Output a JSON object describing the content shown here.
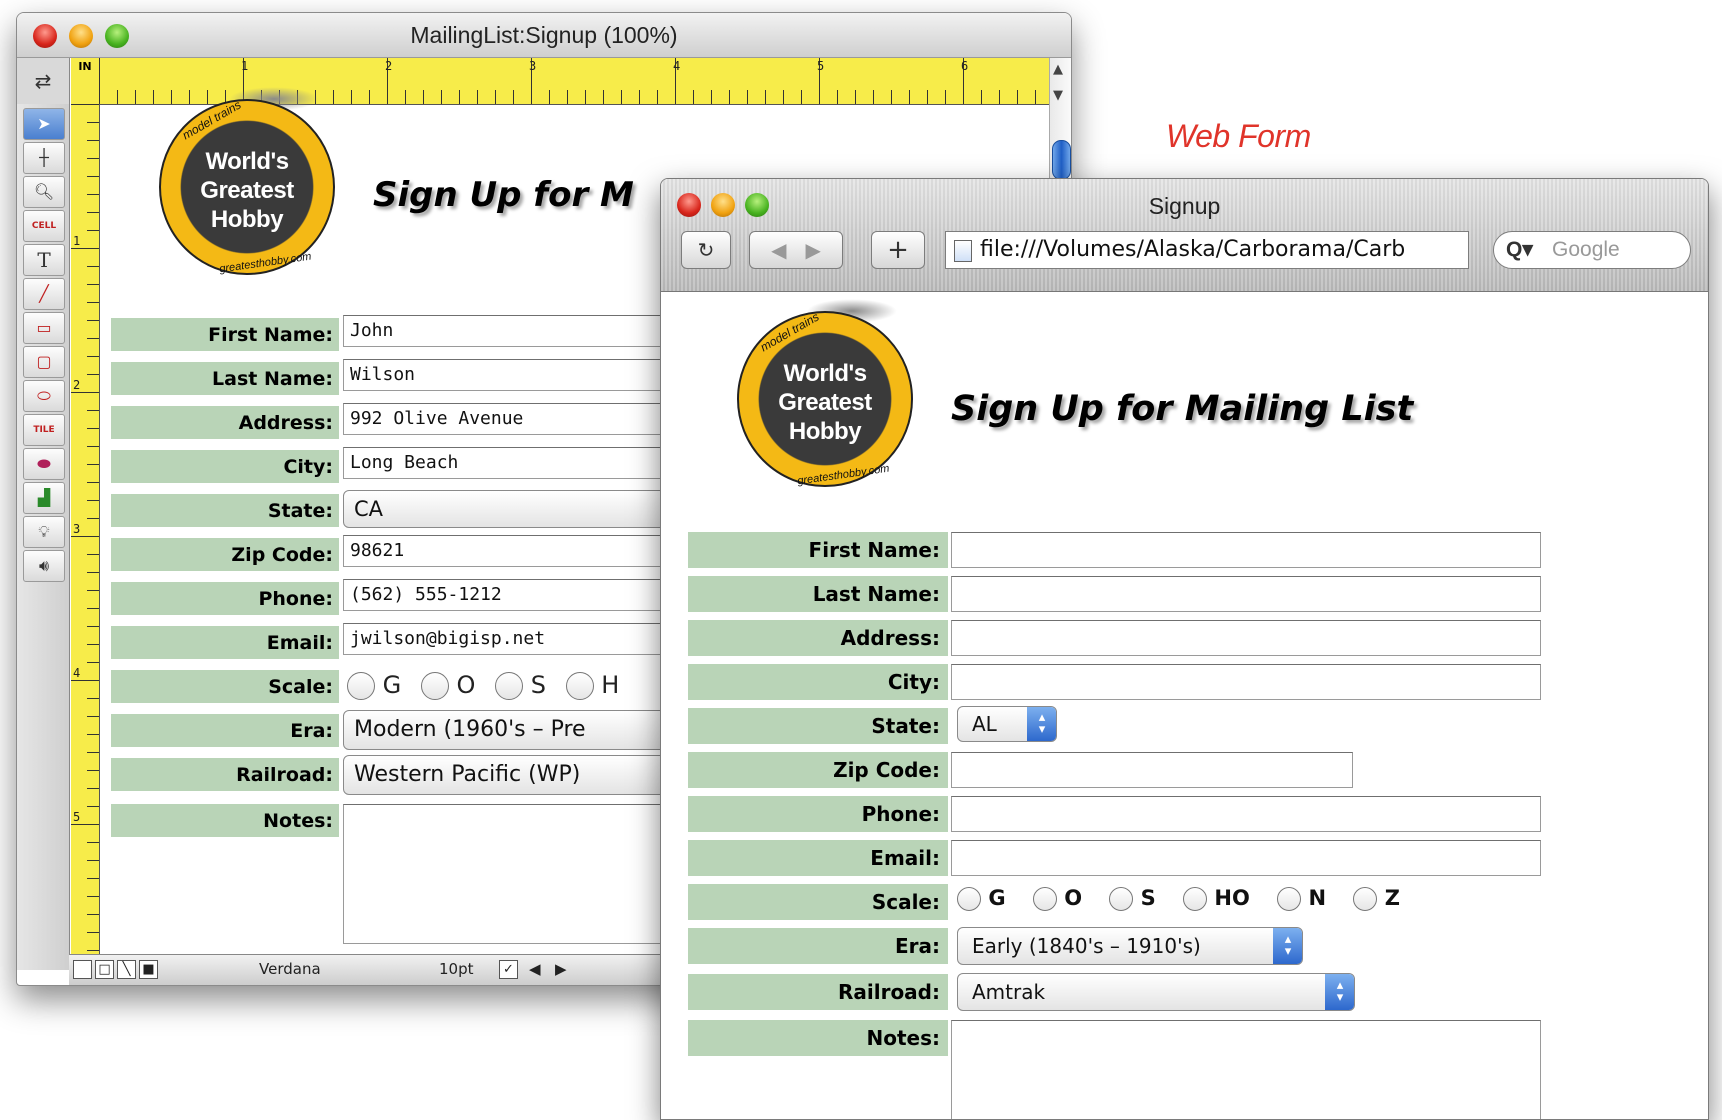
{
  "caption": "Web Form",
  "editor": {
    "title": "MailingList:Signup (100%)",
    "ruler_unit": "IN",
    "ruler_h_ticks": [
      "1",
      "2",
      "3",
      "4",
      "5",
      "6"
    ],
    "ruler_v_ticks": [
      "1",
      "2",
      "3",
      "4",
      "5"
    ],
    "tools": [
      "select",
      "line-cross",
      "magnifier",
      "CELL",
      "T",
      "line",
      "rectangle",
      "rounded-rect",
      "oval",
      "TILE",
      "button",
      "chart",
      "bulb",
      "speaker"
    ],
    "logo": {
      "line1": "World's",
      "line2": "Greatest",
      "line3": "Hobby",
      "top_text": "model trains",
      "bottom_text": "greatesthobby.com"
    },
    "heading": "Sign Up for M",
    "labels": {
      "first_name": "First Name:",
      "last_name": "Last Name:",
      "address": "Address:",
      "city": "City:",
      "state": "State:",
      "zip": "Zip Code:",
      "phone": "Phone:",
      "email": "Email:",
      "scale": "Scale:",
      "era": "Era:",
      "railroad": "Railroad:",
      "notes": "Notes:"
    },
    "values": {
      "first_name": "John",
      "last_name": "Wilson",
      "address": "992 Olive Avenue",
      "city": "Long Beach",
      "state": "CA",
      "zip": "98621",
      "phone": "(562) 555-1212",
      "email": "jwilson@bigisp.net",
      "era": "Modern (1960's – Pre",
      "railroad": "Western Pacific (WP)"
    },
    "scale_options": [
      "G",
      "O",
      "S",
      "H"
    ],
    "status": {
      "font": "Verdana",
      "size": "10pt"
    }
  },
  "browser": {
    "title": "Signup",
    "address": "file:///Volumes/Alaska/Carborama/Carb",
    "search_placeholder": "Google",
    "logo": {
      "line1": "World's",
      "line2": "Greatest",
      "line3": "Hobby",
      "top_text": "model trains",
      "bottom_text": "greatesthobby.com"
    },
    "heading": "Sign Up for Mailing List",
    "labels": {
      "first_name": "First Name:",
      "last_name": "Last Name:",
      "address": "Address:",
      "city": "City:",
      "state": "State:",
      "zip": "Zip Code:",
      "phone": "Phone:",
      "email": "Email:",
      "scale": "Scale:",
      "era": "Era:",
      "railroad": "Railroad:",
      "notes": "Notes:"
    },
    "state_value": "AL",
    "era_value": "Early (1840's – 1910's)",
    "railroad_value": "Amtrak",
    "scale_options": [
      "G",
      "O",
      "S",
      "HO",
      "N",
      "Z"
    ]
  }
}
